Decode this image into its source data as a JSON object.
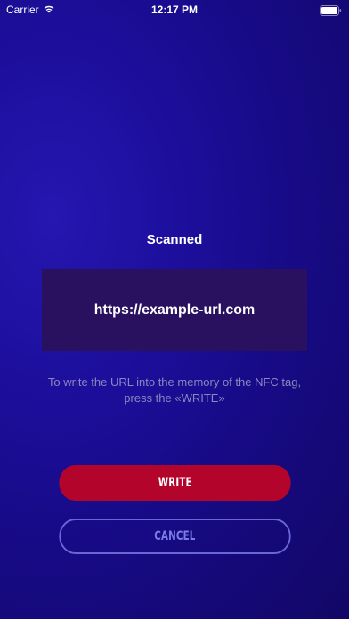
{
  "status_bar": {
    "carrier": "Carrier",
    "time": "12:17 PM",
    "icons": [
      "wifi-icon",
      "battery-icon"
    ]
  },
  "main": {
    "title": "Scanned",
    "url": "https://example-url.com",
    "hint": "To write the URL into the memory of the NFC tag, press the «WRITE»"
  },
  "actions": {
    "write_label": "WRITE",
    "cancel_label": "CANCEL"
  },
  "colors": {
    "background": "#1d0f9c",
    "url_box": "#29115f",
    "write_button": "#b3052c",
    "cancel_border": "#6a66d6",
    "cancel_text": "#7b7be8",
    "hint_text": "#8b86bf"
  }
}
